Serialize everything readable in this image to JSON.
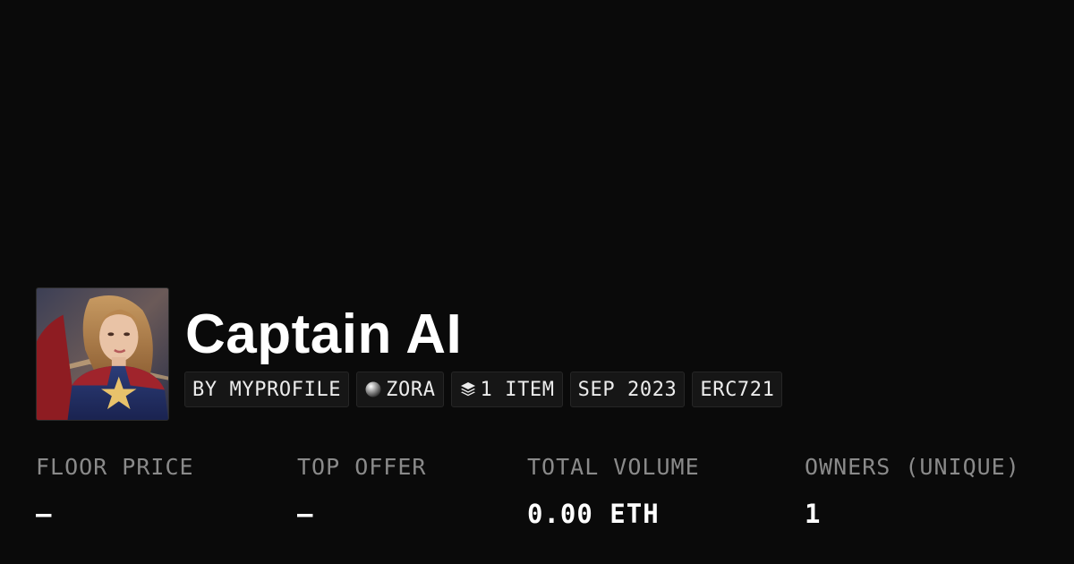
{
  "collection": {
    "name": "Captain AI",
    "avatar_alt": "collection-avatar"
  },
  "chips": [
    {
      "label": "BY MYPROFILE",
      "icon": ""
    },
    {
      "label": "ZORA",
      "icon": "zora-orb-icon"
    },
    {
      "label": "1 ITEM",
      "icon": "layers-icon"
    },
    {
      "label": "SEP 2023",
      "icon": ""
    },
    {
      "label": "ERC721",
      "icon": ""
    }
  ],
  "stats": [
    {
      "label": "FLOOR PRICE",
      "value": "—"
    },
    {
      "label": "TOP OFFER",
      "value": "—"
    },
    {
      "label": "TOTAL VOLUME",
      "value": "0.00 ETH"
    },
    {
      "label": "OWNERS (UNIQUE)",
      "value": "1"
    }
  ],
  "colors": {
    "background": "#0a0a0a",
    "chip_background": "#161616",
    "label": "#8a8a8a",
    "value": "#ffffff"
  }
}
